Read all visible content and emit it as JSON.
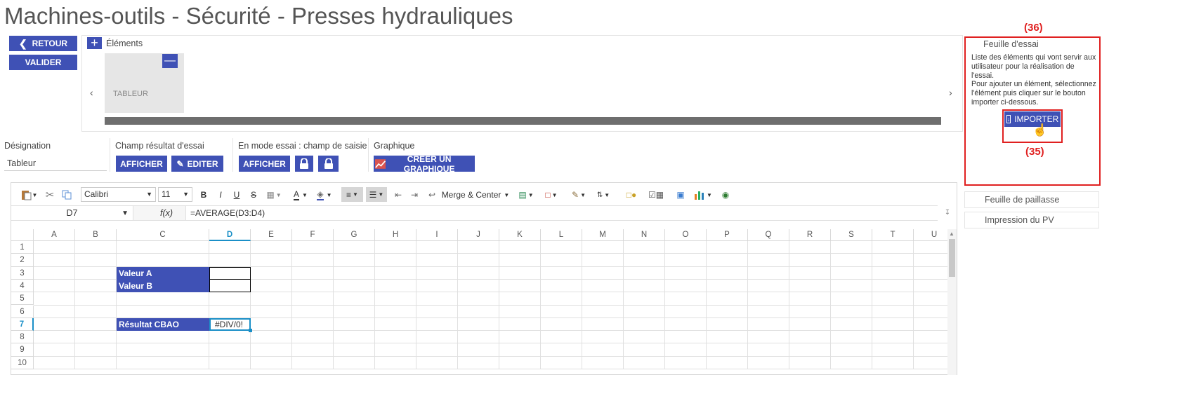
{
  "page": {
    "title": "Machines-outils - Sécurité - Presses hydrauliques"
  },
  "left_buttons": {
    "back": "RETOUR",
    "validate": "VALIDER"
  },
  "elements": {
    "add_label": "Éléments",
    "card_label": "TABLEUR"
  },
  "fields": {
    "designation_label": "Désignation",
    "designation_value": "Tableur",
    "result_label": "Champ résultat d'essai",
    "result_show": "AFFICHER",
    "result_edit": "EDITER",
    "mode_label": "En mode essai : champ de saisie",
    "mode_show": "AFFICHER",
    "graph_label": "Graphique",
    "graph_create": "CRÉER UN GRAPHIQUE"
  },
  "toolbar": {
    "font": "Calibri",
    "size": "11",
    "bold": "B",
    "italic": "I",
    "underline": "U",
    "strike": "S",
    "font_color": "A",
    "merge": "Merge & Center"
  },
  "formula_bar": {
    "cell_ref": "D7",
    "fx": "f(x)",
    "formula": "=AVERAGE(D3:D4)"
  },
  "sheet": {
    "columns": [
      "A",
      "B",
      "C",
      "D",
      "E",
      "F",
      "G",
      "H",
      "I",
      "J",
      "K",
      "L",
      "M",
      "N",
      "O",
      "P",
      "Q",
      "R",
      "S",
      "T",
      "U"
    ],
    "rows": [
      "1",
      "2",
      "3",
      "4",
      "5",
      "6",
      "7",
      "8",
      "9",
      "10"
    ],
    "cells": {
      "c3": "Valeur A",
      "c4": "Valeur B",
      "c7": "Résultat CBAO",
      "d7": "#DIV/0!"
    }
  },
  "side_panel": {
    "title": "Feuille d'essai",
    "description": "Liste des éléments qui vont servir aux utilisateur pour la réalisation de l'essai.\nPour ajouter un élément, sélectionnez l'élément puis cliquer sur le bouton importer ci-dessous.",
    "import_button": "IMPORTER",
    "tab_paillasse": "Feuille de paillasse",
    "tab_pv": "Impression du PV"
  },
  "annotations": {
    "panel": "(36)",
    "button": "(35)"
  },
  "colors": {
    "primary": "#3f51b5",
    "annotation": "#e02020",
    "selected": "#1a8fc7"
  }
}
